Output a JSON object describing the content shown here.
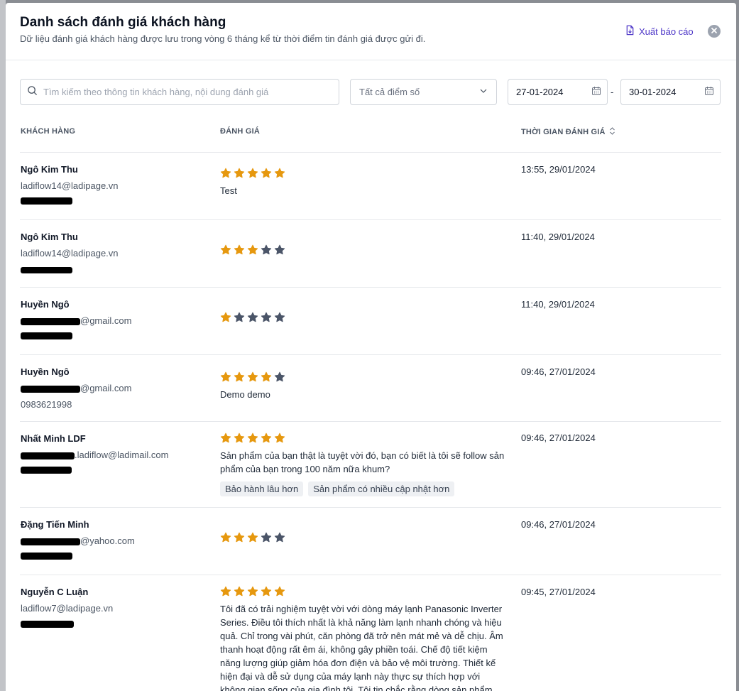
{
  "modal": {
    "title": "Danh sách đánh giá khách hàng",
    "subtitle": "Dữ liệu đánh giá khách hàng được lưu trong vòng 6 tháng kể từ thời điểm tin đánh giá được gửi đi.",
    "export_label": "Xuất báo cáo"
  },
  "filters": {
    "search_placeholder": "Tìm kiếm theo thông tin khách hàng, nội dung đánh giá",
    "score_select": "Tất cả điểm số",
    "date_from": "27-01-2024",
    "date_separator": "-",
    "date_to": "30-01-2024"
  },
  "table": {
    "headers": {
      "customer": "KHÁCH HÀNG",
      "review": "ĐÁNH GIÁ",
      "time": "THỜI GIAN ĐÁNH GIÁ"
    },
    "rows": [
      {
        "name": "Ngô Kim Thu",
        "email": "ladiflow14@ladipage.vn",
        "phone": "",
        "rating": 5,
        "text": "Test",
        "tags": [],
        "time": "13:55, 29/01/2024"
      },
      {
        "name": "Ngô Kim Thu",
        "email": "ladiflow14@ladipage.vn",
        "phone": "",
        "rating": 3,
        "text": "",
        "tags": [],
        "time": "11:40, 29/01/2024"
      },
      {
        "name": "Huyền Ngô",
        "email": "@gmail.com",
        "phone": "",
        "rating": 1,
        "text": "",
        "tags": [],
        "time": "11:40, 29/01/2024"
      },
      {
        "name": "Huyền Ngô",
        "email": "@gmail.com",
        "phone": "0983621998",
        "rating": 4,
        "text": "Demo demo",
        "tags": [],
        "time": "09:46, 27/01/2024"
      },
      {
        "name": "Nhất Minh LDF",
        "email": ".ladiflow@ladimail.com",
        "phone": "",
        "rating": 5,
        "text": "Sản phẩm của bạn thật là tuyệt vời đó, bạn có biết là tôi sẽ follow sản phẩm của bạn trong 100 năm nữa khum?",
        "tags": [
          "Bảo hành lâu hơn",
          "Sản phẩm có nhiều cập nhật hơn"
        ],
        "time": "09:46, 27/01/2024"
      },
      {
        "name": "Đặng Tiến Minh",
        "email": "@yahoo.com",
        "phone": "",
        "rating": 3,
        "text": "",
        "tags": [],
        "time": "09:46, 27/01/2024"
      },
      {
        "name": "Nguyễn C Luận",
        "email": "ladiflow7@ladipage.vn",
        "phone": "",
        "rating": 5,
        "text": "Tôi đã có trải nghiệm tuyệt vời với dòng máy lạnh Panasonic Inverter Series. Điều tôi thích nhất là khả năng làm lạnh nhanh chóng và hiệu quả. Chỉ trong vài phút, căn phòng đã trở nên mát mẻ và dễ chịu. Âm thanh hoạt động rất êm ái, không gây phiền toái. Chế độ tiết kiệm năng lượng giúp giảm hóa đơn điện và bảo vệ môi trường. Thiết kế hiện đại và dễ sử dụng của máy lạnh này thực sự thích hợp với không gian sống của gia đình tôi. Tôi tin chắc rằng dòng sản phẩm này là lựa",
        "tags": [],
        "time": "09:45, 27/01/2024"
      }
    ]
  },
  "colors": {
    "star_filled": "#e6980f",
    "star_empty": "#4b5568",
    "accent": "#4c35c7"
  }
}
